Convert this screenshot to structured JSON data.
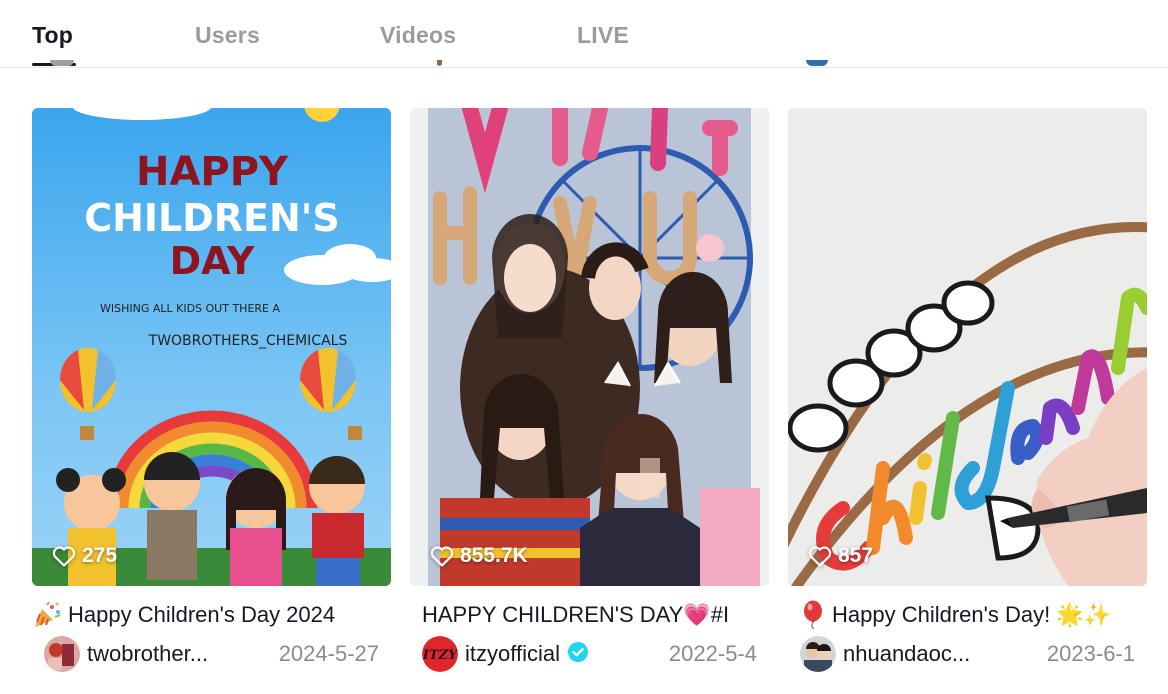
{
  "tabs": [
    {
      "label": "Top",
      "active": true
    },
    {
      "label": "Users",
      "active": false
    },
    {
      "label": "Videos",
      "active": false
    },
    {
      "label": "LIVE",
      "active": false
    }
  ],
  "cards": [
    {
      "likes": "275",
      "caption_emoji": "party-popper-icon",
      "caption": "Happy Children's Day 2024",
      "username": "twobrother...",
      "verified": false,
      "date": "2024-5-27",
      "thumb_text": {
        "line1": "HAPPY",
        "line2": "CHILDREN'S",
        "line3": "DAY",
        "wishing": "WISHING ALL KIDS OUT THERE A",
        "brand": "TWOBROTHERS_CHEMICALS"
      }
    },
    {
      "likes": "855.7K",
      "caption": "HAPPY CHILDREN'S DAY💗#I",
      "username": "itzyofficial",
      "verified": true,
      "date": "2022-5-4"
    },
    {
      "likes": "857",
      "caption_emoji": "balloon-icon",
      "caption": "Happy Children's Day! 🌟✨",
      "username": "nhuandaoc...",
      "verified": false,
      "date": "2023-6-1"
    }
  ],
  "colors": {
    "active_tab": "#161823",
    "inactive_tab": "#9a9ba1",
    "date_text": "#8a8b91",
    "verified_badge": "#20d5ec"
  }
}
